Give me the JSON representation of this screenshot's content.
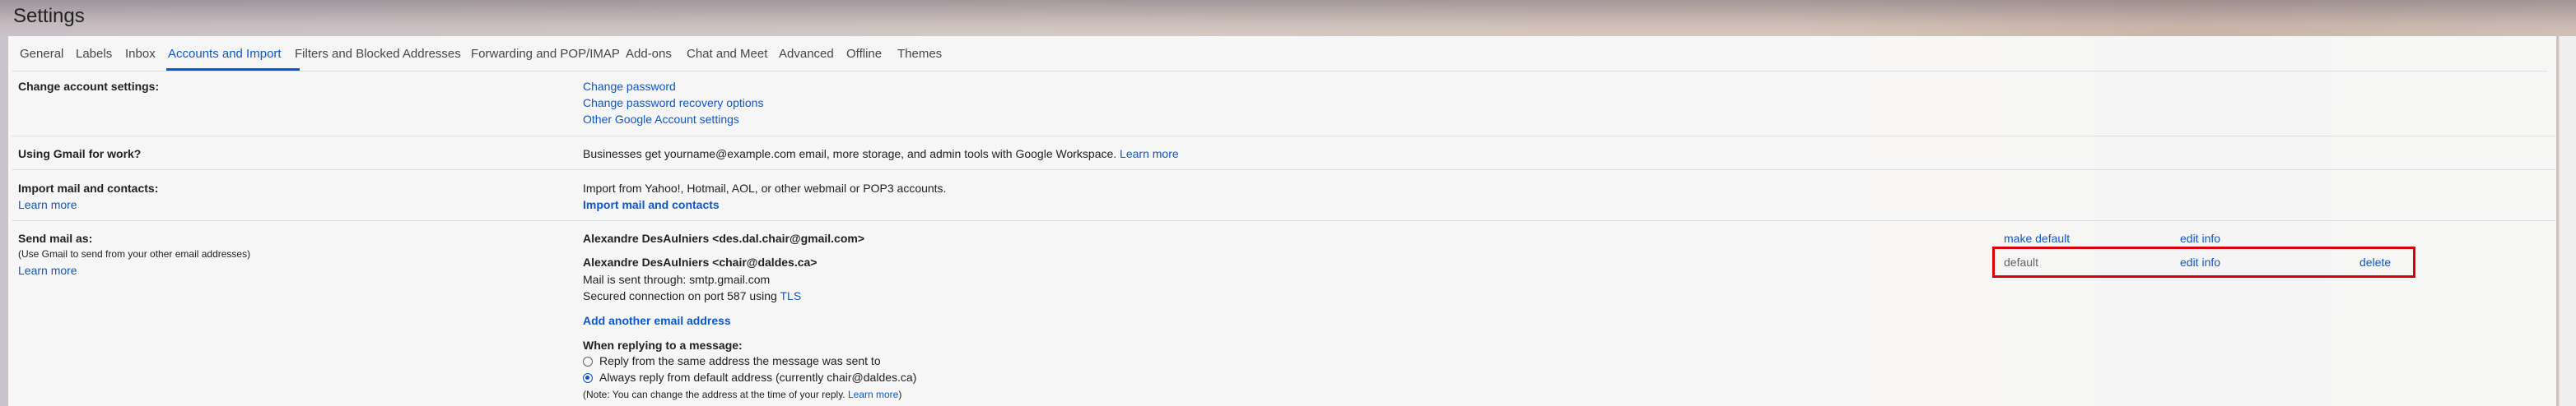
{
  "header": {
    "title": "Settings"
  },
  "tabs": [
    {
      "label": "General"
    },
    {
      "label": "Labels"
    },
    {
      "label": "Inbox"
    },
    {
      "label": "Accounts and Import"
    },
    {
      "label": "Filters and Blocked Addresses"
    },
    {
      "label": "Forwarding and POP/IMAP"
    },
    {
      "label": "Add-ons"
    },
    {
      "label": "Chat and Meet"
    },
    {
      "label": "Advanced"
    },
    {
      "label": "Offline"
    },
    {
      "label": "Themes"
    }
  ],
  "change_account": {
    "label": "Change account settings:",
    "links": [
      "Change password",
      "Change password recovery options",
      "Other Google Account settings"
    ]
  },
  "gmail_work": {
    "label": "Using Gmail for work?",
    "text": "Businesses get yourname@example.com email, more storage, and admin tools with Google Workspace.",
    "learn_more": "Learn more"
  },
  "import_mail": {
    "label": "Import mail and contacts:",
    "learn_more": "Learn more",
    "text": "Import from Yahoo!, Hotmail, AOL, or other webmail or POP3 accounts.",
    "action": "Import mail and contacts"
  },
  "send_mail": {
    "label": "Send mail as:",
    "sub": "(Use Gmail to send from your other email addresses)",
    "learn_more": "Learn more",
    "addresses": [
      {
        "name": "Alexandre DesAulniers <des.dal.chair@gmail.com>",
        "status": "make default",
        "edit": "edit info"
      },
      {
        "name": "Alexandre DesAulniers <chair@daldes.ca>",
        "status": "default",
        "edit": "edit info",
        "delete": "delete",
        "detail1": "Mail is sent through: smtp.gmail.com",
        "detail2": "Secured connection on port 587 using",
        "tls": "TLS"
      }
    ],
    "add_another": "Add another email address",
    "reply_heading": "When replying to a message:",
    "reply_options": [
      {
        "label": "Reply from the same address the message was sent to",
        "selected": false
      },
      {
        "label": "Always reply from default address (currently chair@daldes.ca)",
        "selected": true
      }
    ],
    "note": "(Note: You can change the address at the time of your reply.",
    "note_link": "Learn more",
    "note_end": ")"
  },
  "colors": {
    "accent": "#0b57d0",
    "highlight": "#d9000d"
  }
}
